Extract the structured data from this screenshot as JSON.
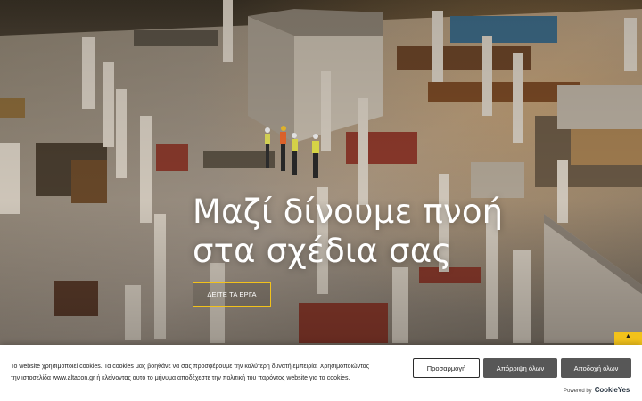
{
  "hero": {
    "title_line1": "Μαζί δίνουμε πνοή",
    "title_line2": "στα σχέδια σας",
    "cta_label": "ΔΕΙΤΕ ΤΑ ΕΡΓΑ"
  },
  "scroll_tab": {
    "icon": "chevron-up-icon",
    "glyph": "▲"
  },
  "cookie_banner": {
    "text_line1": "Το website χρησιμοποιεί cookies. Τα cookies μας βοηθάνε να σας προσφέρουμε την καλύτερη δυνατή εμπειρία. Χρησιμοποιώντας",
    "text_line2": "την ιστοσελίδα www.altacon.gr ή κλείνοντας αυτό το μήνυμα αποδέχεστε την πολιτική του παρόντος website για τα cookies.",
    "customize_label": "Προσαρμογή",
    "reject_label": "Απόρριψη όλων",
    "accept_label": "Αποδοχή όλων",
    "powered_label": "Powered by",
    "powered_brand": "CookieYes"
  },
  "colors": {
    "accent": "#f2c21b",
    "button_dark": "#575757",
    "cookie_bg": "#ffffff"
  }
}
